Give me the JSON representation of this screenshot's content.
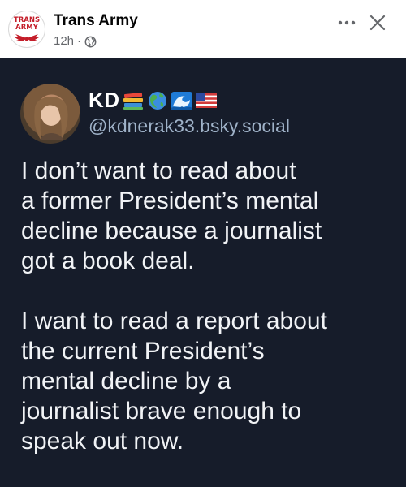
{
  "header": {
    "logo_text_line1": "TRANS",
    "logo_text_line2": "ARMY",
    "page_name": "Trans Army",
    "time": "12h",
    "separator": "·",
    "privacy_icon": "globe-icon",
    "more_icon": "more-horizontal-icon",
    "close_icon": "close-icon"
  },
  "embedded_post": {
    "display_name": "KD",
    "display_name_emojis": [
      "books-emoji",
      "globe-americas-emoji",
      "water-wave-emoji",
      "us-flag-emoji"
    ],
    "handle": "@kdnerak33.bsky.social",
    "paragraph1": "I don’t want to read about\na former President’s mental\ndecline because a journalist\ngot a book deal.",
    "paragraph2": "I want to read a report about\nthe current President’s\nmental decline by a\njournalist brave enough to\nspeak out now."
  },
  "colors": {
    "post_background": "#161c2a",
    "post_text": "#f1f3f6",
    "handle_text": "#9fb2c8",
    "logo_red": "#c41e2a",
    "meta_gray": "#65676b"
  }
}
